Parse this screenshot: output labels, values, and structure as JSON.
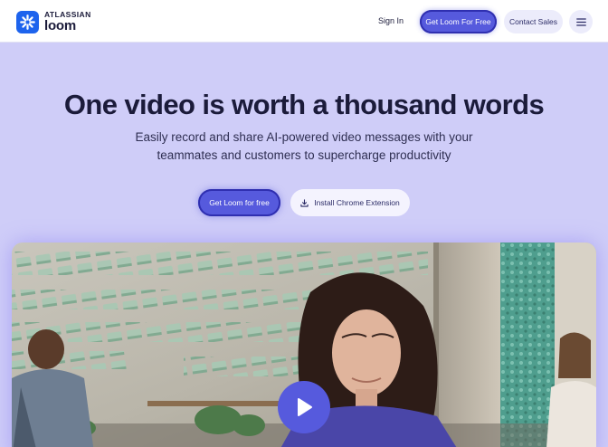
{
  "header": {
    "logo": {
      "brand": "ATLASSIAN",
      "product": "loom",
      "icon": "loom-starburst-icon"
    },
    "nav": {
      "signin": "Sign In",
      "cta": "Get Loom For Free",
      "contact": "Contact Sales",
      "menu_icon": "hamburger-menu-icon"
    }
  },
  "hero": {
    "title": "One video is worth a thousand words",
    "subtitle": "Easily record and share AI-powered video messages with your teammates and customers to supercharge productivity",
    "primary_button": "Get Loom for free",
    "secondary_button": "Install Chrome Extension",
    "secondary_icon": "download-icon"
  },
  "video": {
    "play_icon": "play-icon"
  },
  "colors": {
    "accent": "#565add",
    "page_bg": "#cfcdf8",
    "brand_blue": "#1d63ed",
    "text_dark": "#1b1b3a"
  }
}
